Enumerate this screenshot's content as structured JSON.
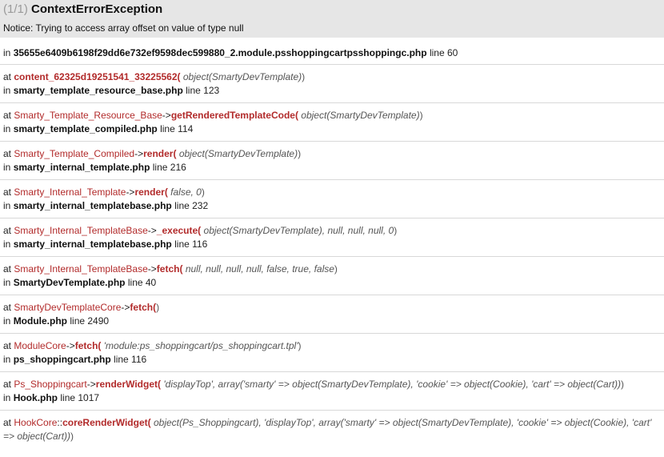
{
  "header": {
    "count": "(1/1)",
    "exception": "ContextErrorException",
    "notice": "Notice: Trying to access array offset on value of type null"
  },
  "origin": {
    "in_label": "in",
    "file": "35655e6409b6198f29dd6e732ef9598dec599880_2.module.psshoppingcartpsshoppingc.php",
    "line": "line 60"
  },
  "frames": [
    {
      "at": "at",
      "class": "",
      "arrow": "",
      "func": "content_62325d19251541_33225562",
      "args_open": "(",
      "args": "object(SmartyDevTemplate)",
      "args_close": ")",
      "in": "in",
      "file": "smarty_template_resource_base.php",
      "line": "line 123"
    },
    {
      "at": "at",
      "class": "Smarty_Template_Resource_Base",
      "arrow": "->",
      "func": "getRenderedTemplateCode",
      "args_open": "(",
      "args": "object(SmartyDevTemplate)",
      "args_close": ")",
      "in": "in",
      "file": "smarty_template_compiled.php",
      "line": "line 114"
    },
    {
      "at": "at",
      "class": "Smarty_Template_Compiled",
      "arrow": "->",
      "func": "render",
      "args_open": "(",
      "args": "object(SmartyDevTemplate)",
      "args_close": ")",
      "in": "in",
      "file": "smarty_internal_template.php",
      "line": "line 216"
    },
    {
      "at": "at",
      "class": "Smarty_Internal_Template",
      "arrow": "->",
      "func": "render",
      "args_open": "(",
      "args": "false, 0",
      "args_close": ")",
      "in": "in",
      "file": "smarty_internal_templatebase.php",
      "line": "line 232"
    },
    {
      "at": "at",
      "class": "Smarty_Internal_TemplateBase",
      "arrow": "->",
      "func": "_execute",
      "args_open": "(",
      "args": "object(SmartyDevTemplate), null, null, null, 0",
      "args_close": ")",
      "in": "in",
      "file": "smarty_internal_templatebase.php",
      "line": "line 116"
    },
    {
      "at": "at",
      "class": "Smarty_Internal_TemplateBase",
      "arrow": "->",
      "func": "fetch",
      "args_open": "(",
      "args": "null, null, null, null, false, true, false",
      "args_close": ")",
      "in": "in",
      "file": "SmartyDevTemplate.php",
      "line": "line 40"
    },
    {
      "at": "at",
      "class": "SmartyDevTemplateCore",
      "arrow": "->",
      "func": "fetch",
      "args_open": "(",
      "args": "",
      "args_close": ")",
      "in": "in",
      "file": "Module.php",
      "line": "line 2490"
    },
    {
      "at": "at",
      "class": "ModuleCore",
      "arrow": "->",
      "func": "fetch",
      "args_open": "(",
      "args": "'module:ps_shoppingcart/ps_shoppingcart.tpl'",
      "args_close": ")",
      "in": "in",
      "file": "ps_shoppingcart.php",
      "line": "line 116"
    },
    {
      "at": "at",
      "class": "Ps_Shoppingcart",
      "arrow": "->",
      "func": "renderWidget",
      "args_open": "(",
      "args": "'displayTop', array('smarty' => object(SmartyDevTemplate), 'cookie' => object(Cookie), 'cart' => object(Cart))",
      "args_close": ")",
      "in": "in",
      "file": "Hook.php",
      "line": "line 1017"
    },
    {
      "at": "at",
      "class": "HookCore",
      "arrow": "::",
      "func": "coreRenderWidget",
      "args_open": "(",
      "args": "object(Ps_Shoppingcart), 'displayTop', array('smarty' => object(SmartyDevTemplate), 'cookie' => object(Cookie), 'cart' => object(Cart))",
      "args_close": ")",
      "in": "",
      "file": "",
      "line": ""
    }
  ],
  "colors": {
    "class_color": "#b22b2b",
    "header_bg": "#e6e6e6",
    "divider": "#d8d8d8"
  }
}
